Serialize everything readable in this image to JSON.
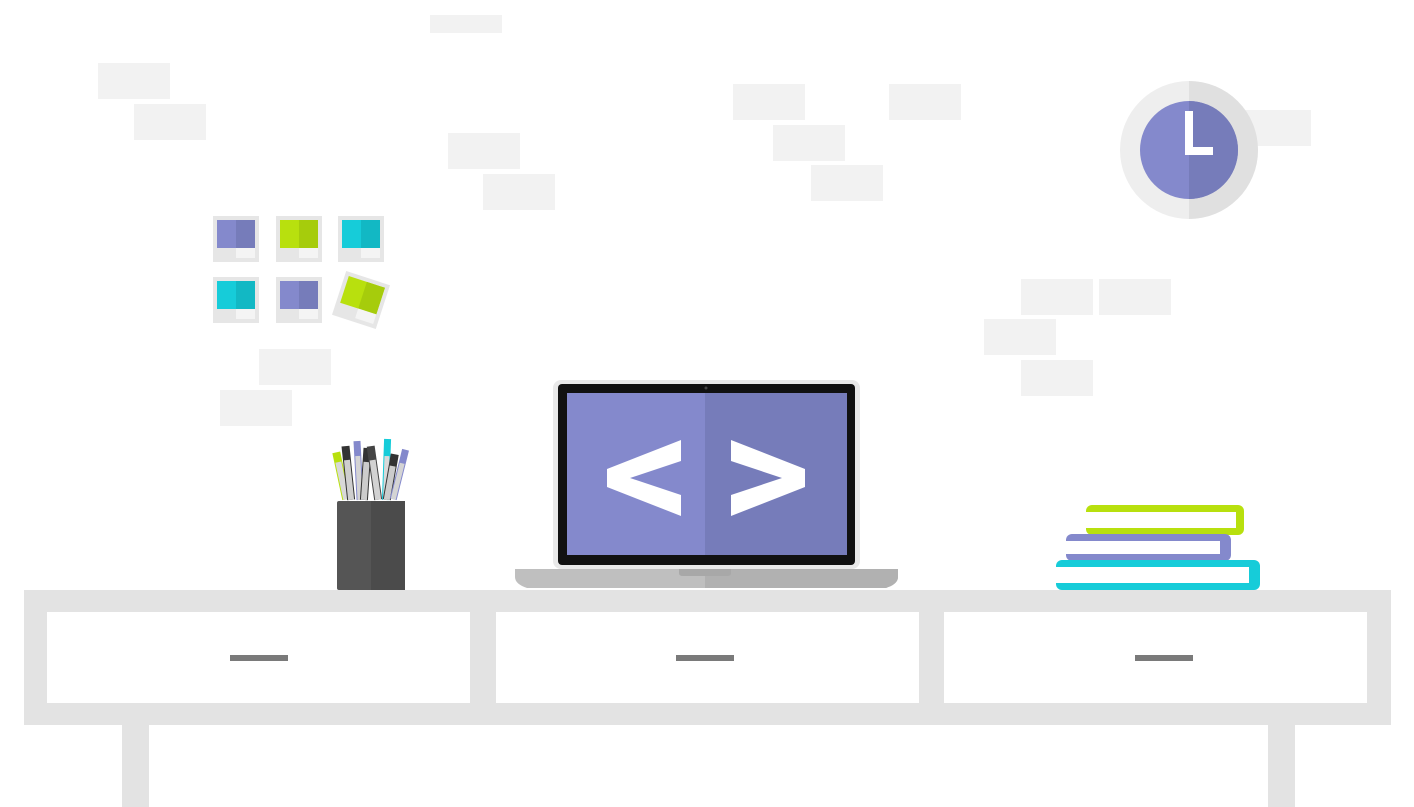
{
  "scene": {
    "code_symbol": "< >",
    "colors": {
      "background": "#ffffff",
      "wall_brick": "#f2f2f2",
      "desk": "#e3e3e3",
      "drawer_face": "#ffffff",
      "drawer_handle": "#7a7a7a",
      "laptop_bezel": "#111111",
      "laptop_frame": "#e9e9e9",
      "laptop_screen_left": "#8489cc",
      "laptop_screen_right": "#767cba",
      "laptop_base": "#bfbfbf",
      "laptop_base_dark": "#a8a8a8",
      "clock_rim": "#eeeeee",
      "clock_face": "#8489cc",
      "clock_hands": "#ffffff",
      "pen_cup": "#555555",
      "accent_purple": "#8489cc",
      "accent_lime": "#b8e00e",
      "accent_cyan": "#16ccd9"
    },
    "pen_cup": {
      "pens": [
        {
          "icon": "marker-icon",
          "color": "#b8e00e"
        },
        {
          "icon": "marker-icon",
          "color": "#333333"
        },
        {
          "icon": "marker-icon",
          "color": "#8489cc"
        },
        {
          "icon": "marker-icon",
          "color": "#333333"
        },
        {
          "icon": "marker-icon",
          "color": "#444444"
        },
        {
          "icon": "marker-icon",
          "color": "#16ccd9"
        },
        {
          "icon": "marker-icon",
          "color": "#333333"
        },
        {
          "icon": "marker-icon",
          "color": "#8489cc"
        }
      ]
    },
    "photos": [
      {
        "color": "#8489cc"
      },
      {
        "color": "#b8e00e"
      },
      {
        "color": "#16ccd9"
      },
      {
        "color": "#16ccd9"
      },
      {
        "color": "#8489cc"
      },
      {
        "color": "#b8e00e"
      }
    ],
    "books": [
      {
        "color": "#b8e00e"
      },
      {
        "color": "#8489cc"
      },
      {
        "color": "#16ccd9"
      }
    ],
    "drawer_count": 3
  }
}
